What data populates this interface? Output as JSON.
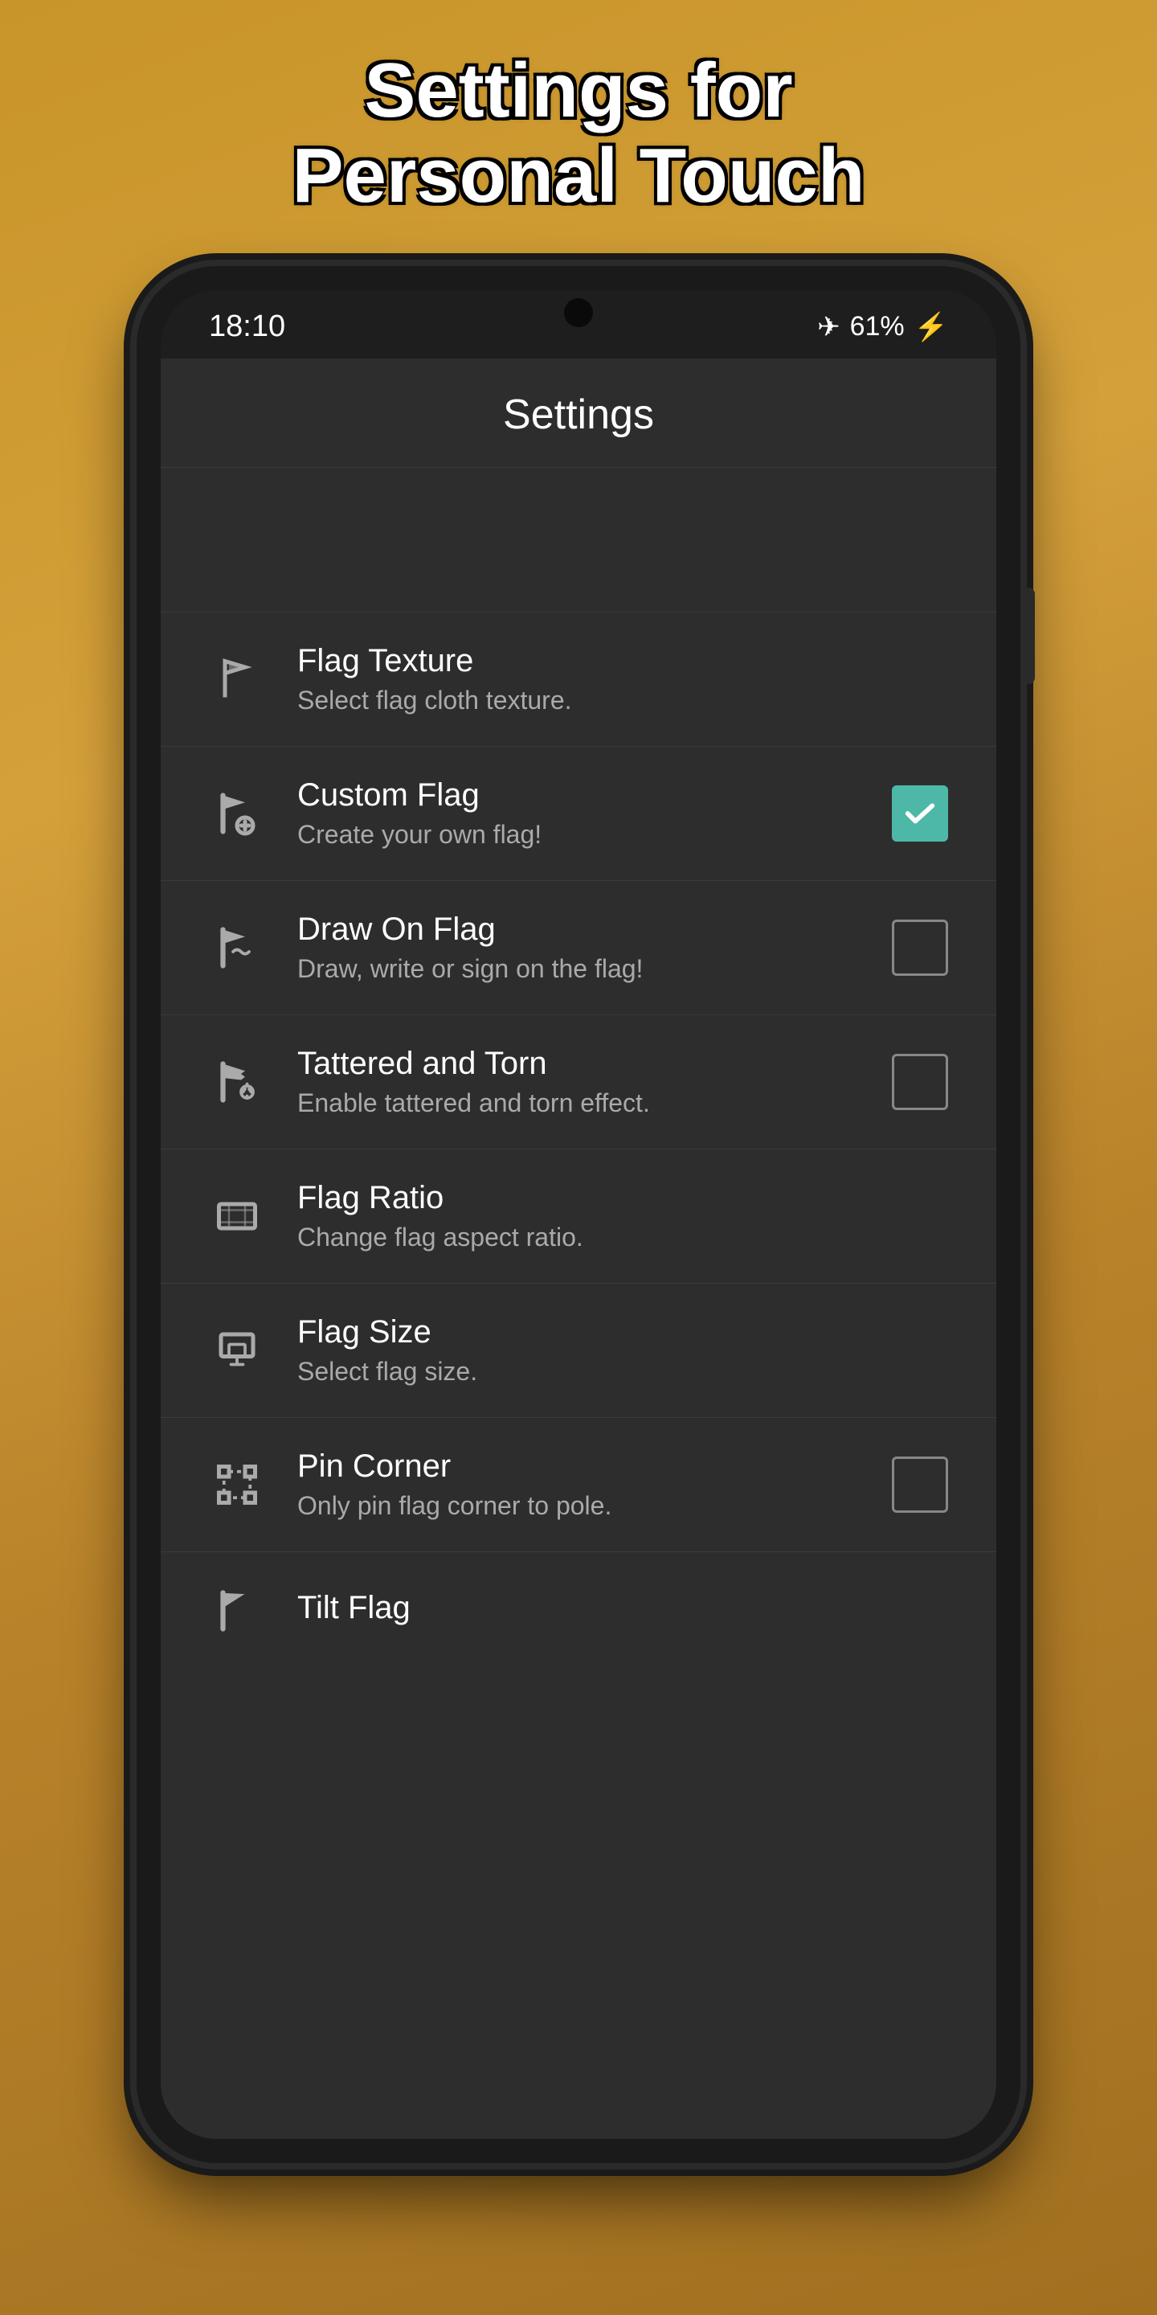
{
  "page": {
    "title_line1": "Settings for",
    "title_line2": "Personal Touch"
  },
  "status_bar": {
    "time": "18:10",
    "battery": "61%",
    "battery_icon": "⚡",
    "wifi_icon": "✈"
  },
  "app_header": {
    "title": "Settings"
  },
  "settings_items": [
    {
      "id": "flag-texture",
      "title": "Flag Texture",
      "subtitle": "Select flag cloth texture.",
      "has_checkbox": false
    },
    {
      "id": "custom-flag",
      "title": "Custom Flag",
      "subtitle": "Create your own flag!",
      "has_checkbox": true,
      "checked": true
    },
    {
      "id": "draw-on-flag",
      "title": "Draw On Flag",
      "subtitle": "Draw, write or sign on the flag!",
      "has_checkbox": true,
      "checked": false
    },
    {
      "id": "tattered-and-torn",
      "title": "Tattered and Torn",
      "subtitle": "Enable tattered and torn effect.",
      "has_checkbox": true,
      "checked": false
    },
    {
      "id": "flag-ratio",
      "title": "Flag Ratio",
      "subtitle": "Change flag aspect ratio.",
      "has_checkbox": false
    },
    {
      "id": "flag-size",
      "title": "Flag Size",
      "subtitle": "Select flag size.",
      "has_checkbox": false
    },
    {
      "id": "pin-corner",
      "title": "Pin Corner",
      "subtitle": "Only pin flag corner to pole.",
      "has_checkbox": true,
      "checked": false
    },
    {
      "id": "tilt-flag",
      "title": "Tilt Flag",
      "subtitle": "",
      "has_checkbox": false,
      "partial": true
    }
  ]
}
